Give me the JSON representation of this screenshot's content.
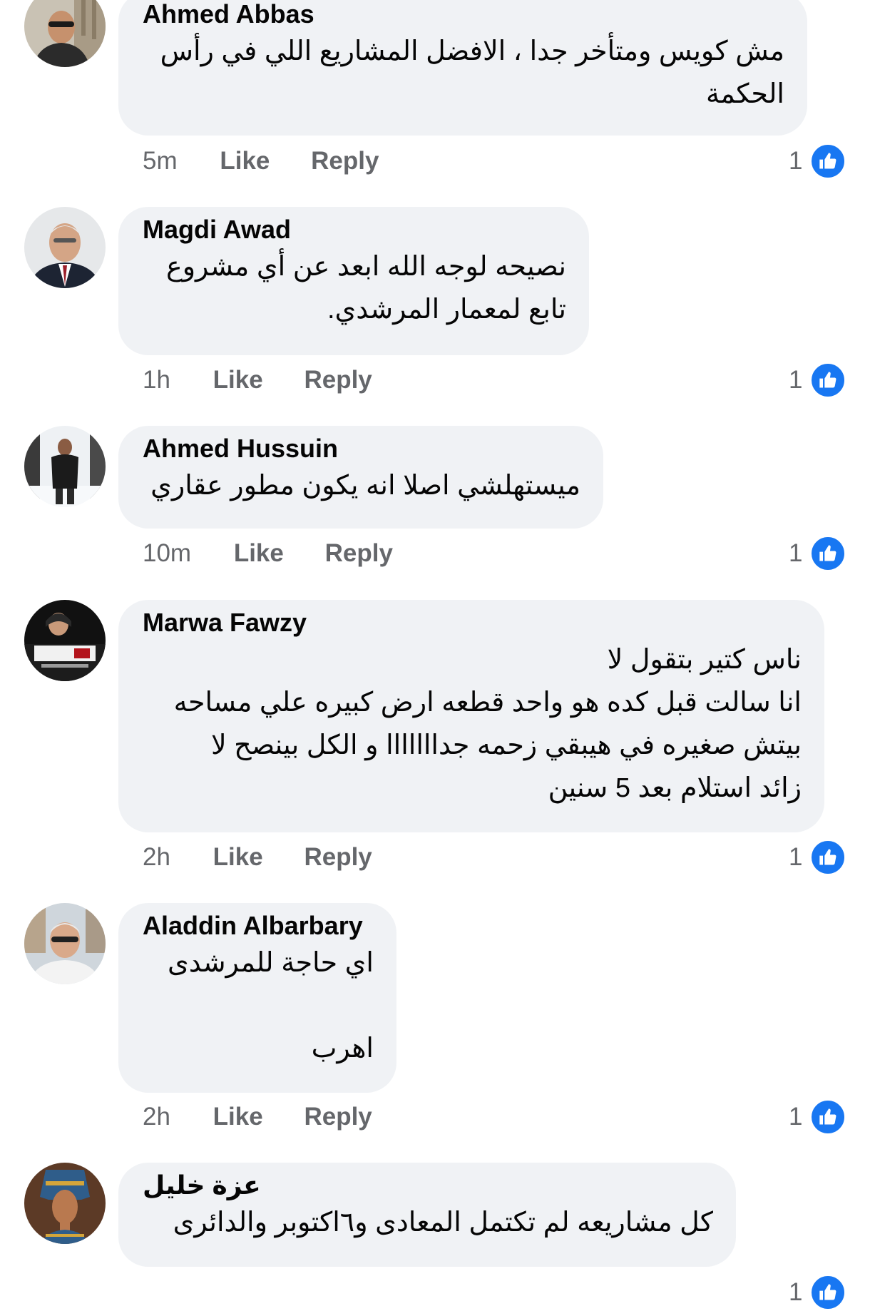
{
  "comments": [
    {
      "author": "Ahmed Abbas",
      "lines": [
        "مش كويس ومتأخر جدا ، الافضل المشاريع اللي في رأس",
        "الحكمة"
      ],
      "time": "5m",
      "like": "Like",
      "reply": "Reply",
      "reactions": "1",
      "avatar": "man-with-sunglasses-photo"
    },
    {
      "author": "Magdi Awad",
      "lines": [
        "نصيحه لوجه الله ابعد عن أي مشروع",
        "تابع لمعمار المرشدي."
      ],
      "time": "1h",
      "like": "Like",
      "reply": "Reply",
      "reactions": "1",
      "avatar": "man-in-suit-photo"
    },
    {
      "author": "Ahmed Hussuin",
      "lines": [
        "ميستهلشي اصلا انه يكون مطور عقاري"
      ],
      "time": "10m",
      "like": "Like",
      "reply": "Reply",
      "reactions": "1",
      "avatar": "person-in-snow-photo"
    },
    {
      "author": "Marwa Fawzy",
      "lines": [
        "ناس كتير بتقول لا",
        "انا سالت قبل كده هو واحد قطعه ارض كبيره علي مساحه",
        "بيتش صغيره في هيبقي زحمه جدااااااا و الكل بينصح لا",
        "زائد استلام بعد 5 سنين"
      ],
      "time": "2h",
      "like": "Like",
      "reply": "Reply",
      "reactions": "1",
      "avatar": "woman-with-logo-photo"
    },
    {
      "author": "Aladdin Albarbary",
      "lines": [
        "اي حاجة للمرشدى",
        "",
        "اهرب"
      ],
      "time": "2h",
      "like": "Like",
      "reply": "Reply",
      "reactions": "1",
      "avatar": "man-with-glasses-photo"
    },
    {
      "author": "عزة خليل",
      "lines": [
        "كل مشاريعه لم تكتمل المعادى و٦اكتوبر والدائرى"
      ],
      "time": "",
      "like": "",
      "reply": "",
      "reactions": "1",
      "avatar": "nefertiti-bust-image"
    }
  ],
  "colors": {
    "bubble": "#f0f2f5",
    "meta_text": "#65676b",
    "like_blue": "#1877f2"
  },
  "icons": {
    "reaction": "thumbs-up-icon"
  }
}
